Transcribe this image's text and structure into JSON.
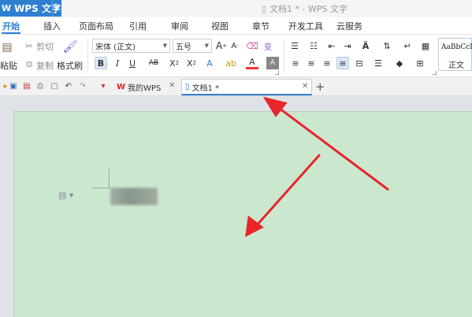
{
  "titlebar": {
    "app_label": "WPS 文字",
    "doc_title": "文档1 * - WPS 文字"
  },
  "ribbon_tabs": [
    "开始",
    "插入",
    "页面布局",
    "引用",
    "审阅",
    "视图",
    "章节",
    "开发工具",
    "云服务"
  ],
  "ribbon": {
    "paste_label": "粘贴",
    "cut_label": "剪切",
    "copy_label": "复制",
    "format_painter_label": "格式刷",
    "font_name": "宋体 (正文)",
    "font_size": "五号",
    "style_preview": "AaBbCcI",
    "style_name": "正文"
  },
  "tabs": {
    "my_wps": "我的WPS",
    "doc": "文档1 *"
  },
  "colors": {
    "accent": "#2f7fd1",
    "page_green": "#cbe8cf",
    "arrow_red": "#e8262b"
  }
}
